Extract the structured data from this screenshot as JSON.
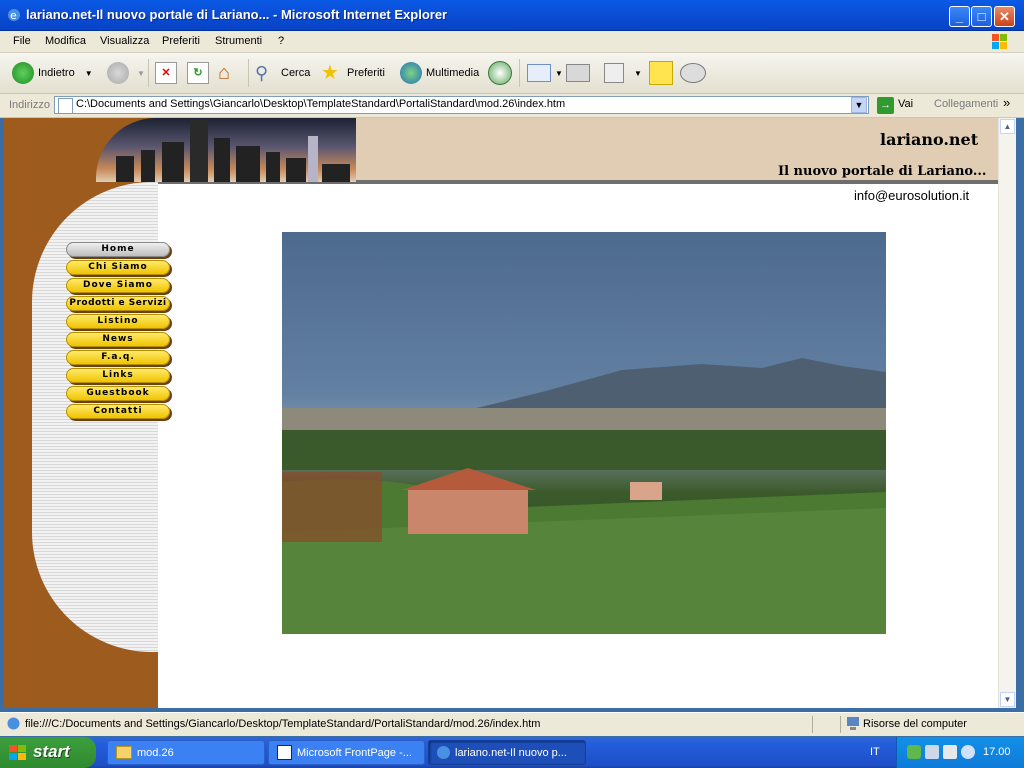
{
  "window": {
    "title": "lariano.net-Il nuovo portale di Lariano... - Microsoft Internet Explorer"
  },
  "menu": [
    "File",
    "Modifica",
    "Visualizza",
    "Preferiti",
    "Strumenti",
    "?"
  ],
  "toolbar": {
    "back_label": "Indietro",
    "search_label": "Cerca",
    "favorites_label": "Preferiti",
    "media_label": "Multimedia"
  },
  "address": {
    "label": "Indirizzo",
    "value": "C:\\Documents and Settings\\Giancarlo\\Desktop\\TemplateStandard\\PortaliStandard\\mod.26\\index.htm",
    "go_label": "Vai",
    "links_label": "Collegamenti"
  },
  "site": {
    "title": "lariano.net",
    "subtitle": "Il nuovo portale di Lariano...",
    "email": "info@eurosolution.it",
    "nav": [
      "Home",
      "Chi Siamo",
      "Dove Siamo",
      "Prodotti e Servizi",
      "Listino",
      "News",
      "F.a.q.",
      "Links",
      "Guestbook",
      "Contatti"
    ]
  },
  "status": {
    "text": "file:///C:/Documents and Settings/Giancarlo/Desktop/TemplateStandard/PortaliStandard/mod.26/index.htm",
    "zone": "Risorse del computer"
  },
  "taskbar": {
    "start_label": "start",
    "tasks": [
      "mod.26",
      "Microsoft FrontPage -...",
      "lariano.net-Il nuovo p..."
    ],
    "language": "IT",
    "clock": "17.00"
  },
  "colors": {
    "titlebar": "#0b4fd8",
    "nav_button": "#f0c400",
    "sidebar_brown": "#9e5b1e"
  }
}
